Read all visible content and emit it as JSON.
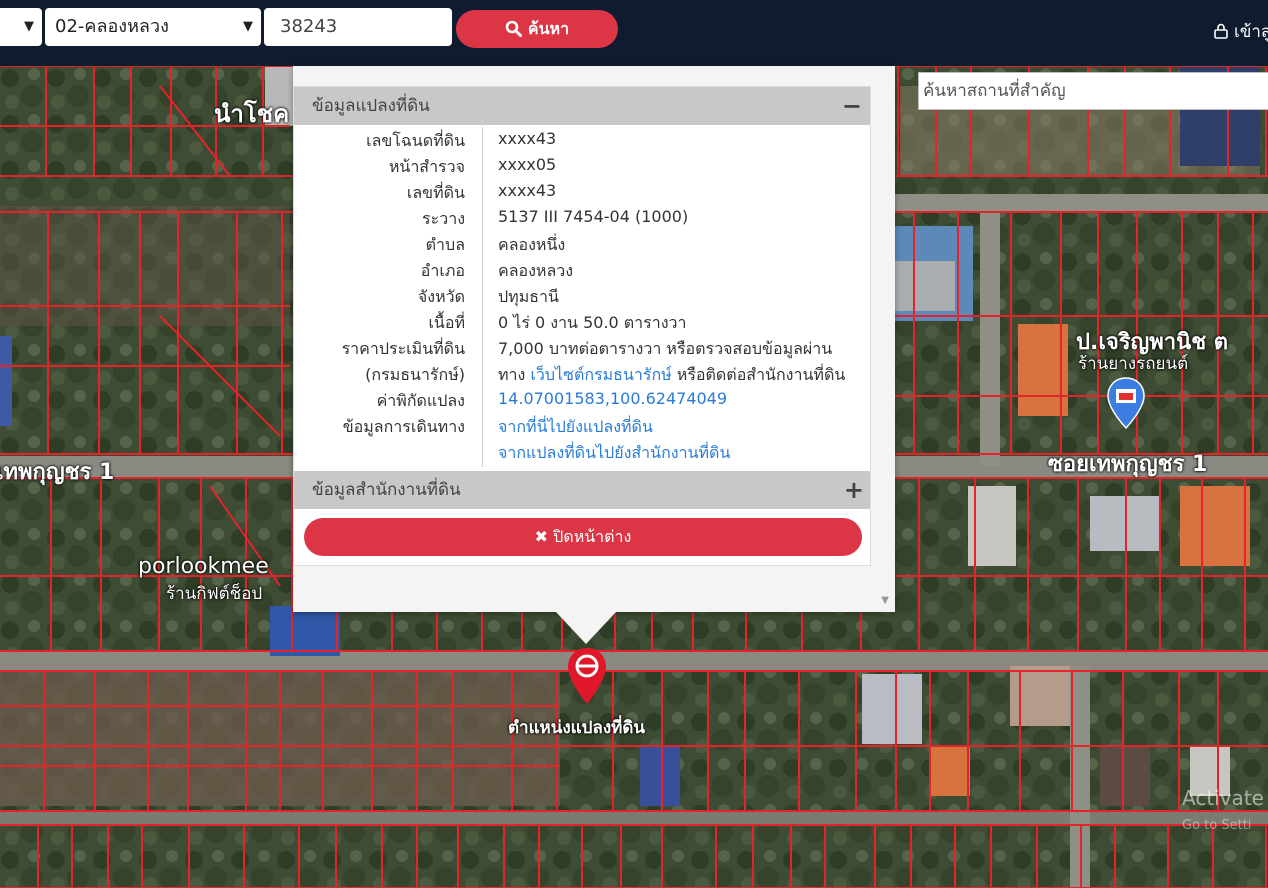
{
  "topbar": {
    "district_select": "02-คลองหลวง",
    "parcel_input": "38243",
    "search_button": "ค้นหา",
    "login": "เข้าสู่"
  },
  "map": {
    "place_search_placeholder": "ค้นหาสถานที่สำคัญ",
    "labels": {
      "shop1": "นำโชค",
      "street_left": "เทพกุญชร 1",
      "street_right": "ซอยเทพกุญชร 1",
      "porlook": "porlookmee",
      "porlook_sub": "ร้านกิฟต์ช็อป",
      "shop_right": "ป.เจริญพานิช ต",
      "shop_right_sub": "ร้านยางรถยนต์"
    },
    "pin_label": "ตำแหน่งแปลงที่ดิน",
    "watermark": "Activate",
    "watermark_sub": "Go to Setti"
  },
  "popup": {
    "section_title": "ข้อมูลแปลงที่ดิน",
    "collapse_icon": "minus-icon",
    "rows": [
      {
        "key": "เลขโฉนดที่ดิน",
        "value": "xxxx43"
      },
      {
        "key": "หน้าสำรวจ",
        "value": "xxxx05"
      },
      {
        "key": "เลขที่ดิน",
        "value": "xxxx43"
      },
      {
        "key": "ระวาง",
        "value": "5137 III 7454-04 (1000)"
      },
      {
        "key": "ตำบล",
        "value": "คลองหนึ่ง"
      },
      {
        "key": "อำเภอ",
        "value": "คลองหลวง"
      },
      {
        "key": "จังหวัด",
        "value": "ปทุมธานี"
      },
      {
        "key": "เนื้อที่",
        "value": "0 ไร่ 0 งาน 50.0 ตารางวา"
      },
      {
        "key": "ราคาประเมินที่ดิน",
        "value": "7,000 บาทต่อตารางวา หรือตรวจสอบข้อมูลผ่าน"
      },
      {
        "key": "(กรมธนารักษ์)",
        "value_pre": "ทาง ",
        "value_link": "เว็บไซต์กรมธนารักษ์",
        "value_post": " หรือติดต่อสำนักงานที่ดิน"
      },
      {
        "key": "ค่าพิกัดแปลง",
        "link": "14.07001583,100.62474049"
      },
      {
        "key": "ข้อมูลการเดินทาง",
        "link": "จากที่นี่ไปยังแปลงที่ดิน"
      },
      {
        "key": "",
        "link": "จากแปลงที่ดินไปยังสำนักงานที่ดิน"
      }
    ],
    "office_title": "ข้อมูลสำนักงานที่ดิน",
    "expand_icon": "plus-icon",
    "close_button": "ปิดหน้าต่าง"
  }
}
